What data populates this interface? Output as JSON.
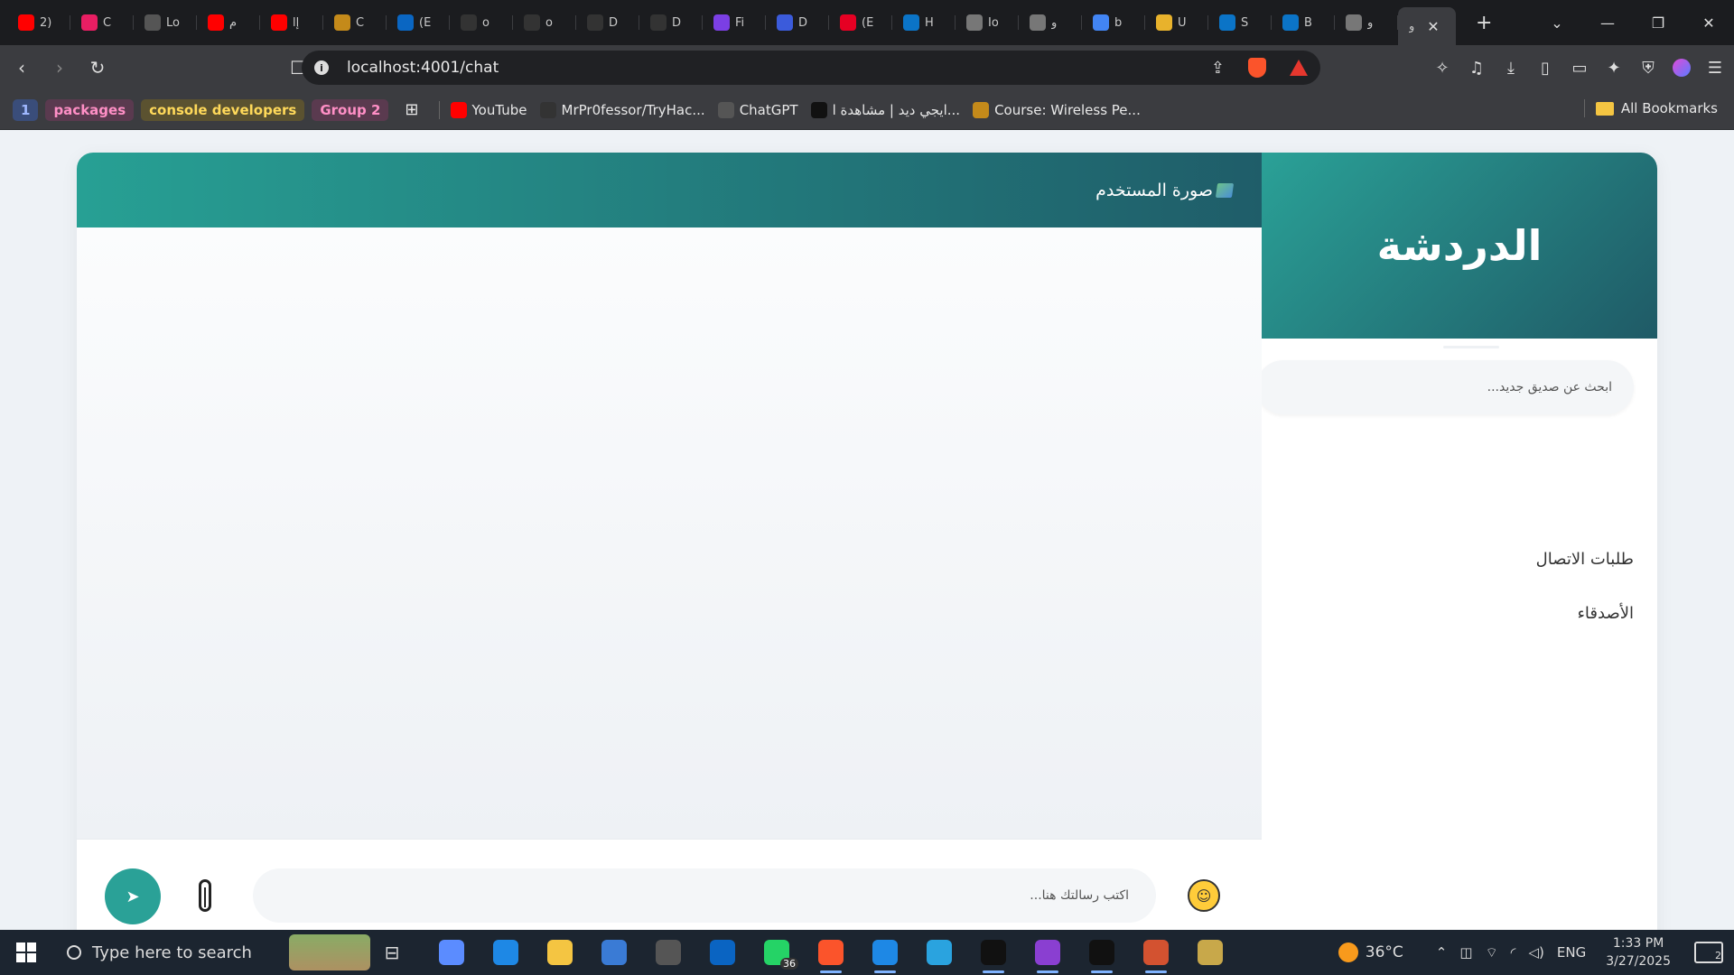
{
  "browser": {
    "tabs": [
      {
        "title": "2)",
        "color": "#ff0000",
        "icon": "youtube-icon"
      },
      {
        "title": "C",
        "color": "#e91e63",
        "icon": "app-icon"
      },
      {
        "title": "Lo",
        "color": "#555555",
        "icon": "chatgpt-icon"
      },
      {
        "title": "م",
        "color": "#ff0000",
        "icon": "youtube-icon"
      },
      {
        "title": "إا",
        "color": "#ff0000",
        "icon": "youtube-icon"
      },
      {
        "title": "C",
        "color": "#c48a1a",
        "icon": "course-icon"
      },
      {
        "title": "(E",
        "color": "#0a66c2",
        "icon": "linkedin-icon"
      },
      {
        "title": "o",
        "color": "#333333",
        "icon": "github-icon"
      },
      {
        "title": "o",
        "color": "#333333",
        "icon": "github-icon"
      },
      {
        "title": "D",
        "color": "#333333",
        "icon": "github-icon"
      },
      {
        "title": "D",
        "color": "#333333",
        "icon": "github-icon"
      },
      {
        "title": "Fi",
        "color": "#7b3fe4",
        "icon": "app-icon"
      },
      {
        "title": "D",
        "color": "#3b5bdb",
        "icon": "app-icon"
      },
      {
        "title": "(E",
        "color": "#e60023",
        "icon": "pinterest-icon"
      },
      {
        "title": "H",
        "color": "#0b74c7",
        "icon": "app-icon"
      },
      {
        "title": "Io",
        "color": "#777777",
        "icon": "globe-icon"
      },
      {
        "title": "و",
        "color": "#777777",
        "icon": "globe-icon"
      },
      {
        "title": "b",
        "color": "#4285f4",
        "icon": "google-icon"
      },
      {
        "title": "U",
        "color": "#e8b22c",
        "icon": "app-icon"
      },
      {
        "title": "S",
        "color": "#0b74c7",
        "icon": "app-icon"
      },
      {
        "title": "B",
        "color": "#0b74c7",
        "icon": "app-icon"
      },
      {
        "title": "و",
        "color": "#777777",
        "icon": "globe-icon"
      }
    ],
    "active_tab": {
      "title": "و"
    },
    "url": "localhost:4001/chat",
    "bookmarks_bar": {
      "groups": [
        "1",
        "packages",
        "console developers",
        "Group 2"
      ],
      "items": [
        {
          "label": "YouTube",
          "color": "#ff0000",
          "icon": "youtube-icon"
        },
        {
          "label": "MrPr0fessor/TryHac...",
          "color": "#333333",
          "icon": "github-icon"
        },
        {
          "label": "ChatGPT",
          "color": "#555555",
          "icon": "chatgpt-icon"
        },
        {
          "label": "ايجي ديد | مشاهدة ا...",
          "color": "#111111",
          "icon": "egydead-icon"
        },
        {
          "label": "Course: Wireless Pe...",
          "color": "#c48a1a",
          "icon": "course-icon"
        }
      ],
      "all_bookmarks": "All Bookmarks"
    }
  },
  "chat": {
    "sidebar": {
      "title": "الدردشة",
      "search_placeholder": "ابحث عن صديق جديد...",
      "requests_label": "طلبات الاتصال",
      "friends_label": "الأصدقاء"
    },
    "header": {
      "user_image_alt": "صورة المستخدم"
    },
    "composer": {
      "placeholder": "اكتب رسالتك هنا...",
      "send_glyph": "➤",
      "emoji_glyph": "☺"
    },
    "accent": "#2aa197"
  },
  "taskbar": {
    "search_placeholder": "Type here to search",
    "apps": [
      {
        "name": "copilot",
        "color": "#5b8cff",
        "open": false
      },
      {
        "name": "edge",
        "color": "#1e88e5",
        "open": false
      },
      {
        "name": "file-explorer",
        "color": "#f4c542",
        "open": false
      },
      {
        "name": "store",
        "color": "#3a7bd5",
        "open": false
      },
      {
        "name": "obs",
        "color": "#555555",
        "open": false
      },
      {
        "name": "outlook",
        "color": "#0a64c2",
        "open": false
      },
      {
        "name": "whatsapp",
        "color": "#25d366",
        "open": false,
        "badge": "36"
      },
      {
        "name": "brave",
        "color": "#fb542b",
        "open": true
      },
      {
        "name": "vscode",
        "color": "#1e88e5",
        "open": true
      },
      {
        "name": "telegram",
        "color": "#2aa3df",
        "open": false
      },
      {
        "name": "app",
        "color": "#111111",
        "open": true
      },
      {
        "name": "app2",
        "color": "#8a3fd1",
        "open": true
      },
      {
        "name": "capcut",
        "color": "#111111",
        "open": true
      },
      {
        "name": "powerpoint",
        "color": "#d35230",
        "open": true
      },
      {
        "name": "league",
        "color": "#c8a84a",
        "open": false
      }
    ],
    "weather": "36°C",
    "language": "ENG",
    "time": "1:33 PM",
    "date": "3/27/2025",
    "notifications": "2"
  }
}
